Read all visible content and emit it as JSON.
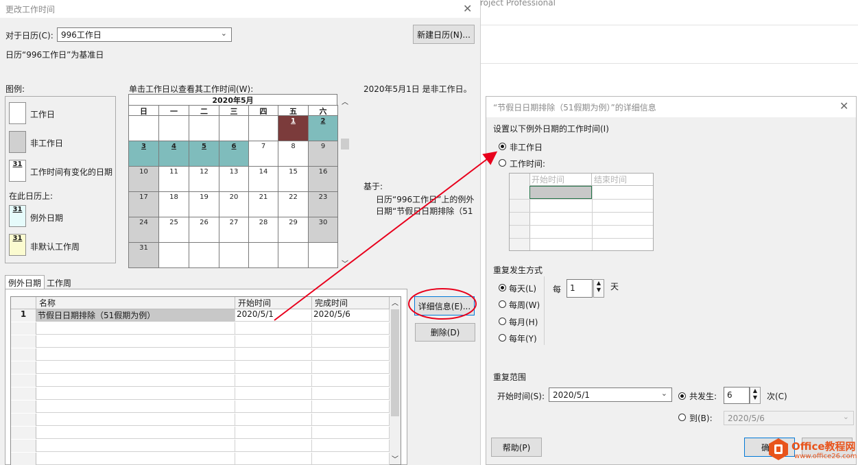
{
  "background_app": {
    "title": "roject Professional"
  },
  "dialog1": {
    "title": "更改工作时间",
    "calendar_label": "对于日历(C):",
    "calendar_value": "996工作日",
    "new_calendar_btn": "新建日历(N)...",
    "base_info": "日历“996工作日”为基准日",
    "legend_title": "图例:",
    "legend": {
      "workday": "工作日",
      "nonworkday": "非工作日",
      "changed": "工作时间有变化的日期",
      "on_calendar": "在此日历上:",
      "exception": "例外日期",
      "nondefault": "非默认工作周",
      "swatch_num": "31"
    },
    "calendar_instruction": "单击工作日以查看其工作时间(W):",
    "month": "2020年5月",
    "weekdays": [
      "日",
      "一",
      "二",
      "三",
      "四",
      "五",
      "六"
    ],
    "status_text": "2020年5月1日 是非工作日。",
    "based_on_label": "基于:",
    "based_on_line1": "日历“996工作日”上的例外",
    "based_on_line2": "日期“节假日日期排除（51",
    "days": [
      {
        "n": "",
        "t": "w"
      },
      {
        "n": "",
        "t": "w"
      },
      {
        "n": "",
        "t": "w"
      },
      {
        "n": "",
        "t": "w"
      },
      {
        "n": "",
        "t": "w"
      },
      {
        "n": "1",
        "t": "sel"
      },
      {
        "n": "2",
        "t": "exc"
      },
      {
        "n": "3",
        "t": "exc"
      },
      {
        "n": "4",
        "t": "exc"
      },
      {
        "n": "5",
        "t": "exc"
      },
      {
        "n": "6",
        "t": "exc"
      },
      {
        "n": "7",
        "t": "w"
      },
      {
        "n": "8",
        "t": "w"
      },
      {
        "n": "9",
        "t": "non"
      },
      {
        "n": "10",
        "t": "non"
      },
      {
        "n": "11",
        "t": "w"
      },
      {
        "n": "12",
        "t": "w"
      },
      {
        "n": "13",
        "t": "w"
      },
      {
        "n": "14",
        "t": "w"
      },
      {
        "n": "15",
        "t": "w"
      },
      {
        "n": "16",
        "t": "non"
      },
      {
        "n": "17",
        "t": "non"
      },
      {
        "n": "18",
        "t": "w"
      },
      {
        "n": "19",
        "t": "w"
      },
      {
        "n": "20",
        "t": "w"
      },
      {
        "n": "21",
        "t": "w"
      },
      {
        "n": "22",
        "t": "w"
      },
      {
        "n": "23",
        "t": "non"
      },
      {
        "n": "24",
        "t": "non"
      },
      {
        "n": "25",
        "t": "w"
      },
      {
        "n": "26",
        "t": "w"
      },
      {
        "n": "27",
        "t": "w"
      },
      {
        "n": "28",
        "t": "w"
      },
      {
        "n": "29",
        "t": "w"
      },
      {
        "n": "30",
        "t": "non"
      },
      {
        "n": "31",
        "t": "non"
      },
      {
        "n": "",
        "t": "w"
      },
      {
        "n": "",
        "t": "w"
      },
      {
        "n": "",
        "t": "w"
      },
      {
        "n": "",
        "t": "w"
      },
      {
        "n": "",
        "t": "w"
      },
      {
        "n": "",
        "t": "w"
      }
    ],
    "tabs": [
      "例外日期",
      "工作周"
    ],
    "table": {
      "columns": [
        "名称",
        "开始时间",
        "完成时间"
      ],
      "rows": [
        {
          "num": "1",
          "name": "节假日日期排除（51假期为例）",
          "start": "2020/5/1",
          "end": "2020/5/6"
        }
      ]
    },
    "details_btn": "详细信息(E)...",
    "delete_btn": "删除(D)"
  },
  "dialog2": {
    "title": "“节假日日期排除（51假期为例）”的详细信息",
    "section1": "设置以下例外日期的工作时间(I)",
    "nonwork_radio": "非工作日",
    "worktime_radio": "工作时间:",
    "grid_cols": [
      "开始时间",
      "结束时间"
    ],
    "recurrence_title": "重复发生方式",
    "recurrence": [
      "每天(L)",
      "每周(W)",
      "每月(H)",
      "每年(Y)"
    ],
    "every_label": "每",
    "every_value": "1",
    "unit": "天",
    "range_title": "重复范围",
    "start_label": "开始时间(S):",
    "start_value": "2020/5/1",
    "occur_label": "共发生:",
    "occur_value": "6",
    "occur_unit": "次(C)",
    "to_label": "到(B):",
    "to_value": "2020/5/6",
    "help_btn": "帮助(P)",
    "ok_btn": "确"
  },
  "watermark": {
    "line1": "Office教程网",
    "line2": "www.office26.com"
  },
  "colors": {
    "selected_day": "#7b3b3b",
    "exception_day": "#7fbcbc",
    "annotation": "#e8001c"
  }
}
